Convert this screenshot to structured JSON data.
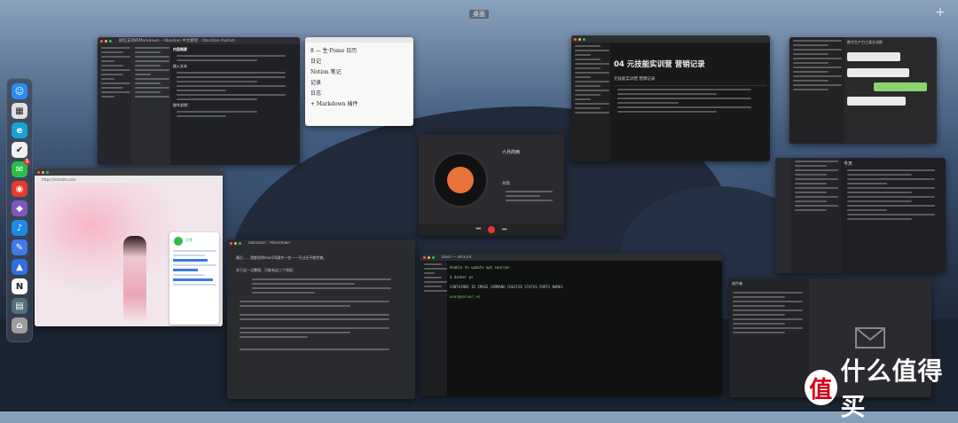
{
  "desktop": {
    "space_label": "桌面",
    "add_space": "+"
  },
  "windows": {
    "joplin": {
      "title": "微信支持的Markdown - Obsidian 中文教程 - Obsidian Publish",
      "heading": "内容概要",
      "section": "插入文本",
      "sub": "指令说明："
    },
    "notes": {
      "lines": [
        "8 — 生·Pomo 日历",
        "日记",
        "Notion 笔记",
        "记录",
        "日志",
        "+ Markdown 插件"
      ]
    },
    "notion": {
      "title": "04 元技能实训营 营销记录",
      "table_title": "元技能实训营 营销记录"
    },
    "music": {
      "song": "六月的雨",
      "artist": "胡歌"
    },
    "browser": {
      "url": "https://smzdm.com",
      "status": "正常"
    },
    "article": {
      "title": "Obsidian · Markdown",
      "p1": "最后……我都觉得macOS操作一些——不过还不够完善。",
      "p2": "关于这一点整理，可能有这三个原因："
    },
    "terminal": {
      "title": "bash — 80×24",
      "lines": [
        "Unable to update apt sources",
        "$ docker ps",
        "CONTAINER ID   IMAGE   COMMAND   CREATED   STATUS   PORTS   NAMES",
        "user@server:~$"
      ]
    },
    "wechat_group": {
      "title": "数字生产力工具交流群"
    },
    "task_app": {
      "title": "今天"
    },
    "mail": {
      "title": "收件箱"
    }
  },
  "dock": {
    "items": [
      {
        "name": "finder-icon",
        "color": "#2a8cf0",
        "glyph": "☺"
      },
      {
        "name": "launchpad-icon",
        "color": "#e0e0e0",
        "glyph": "▦"
      },
      {
        "name": "edge-icon",
        "color": "#1aa0d8",
        "glyph": "e"
      },
      {
        "name": "todo-icon",
        "color": "#f0f0f0",
        "glyph": "✔"
      },
      {
        "name": "wechat-icon",
        "color": "#2bbd4a",
        "glyph": "✉",
        "badge": "1"
      },
      {
        "name": "weibo-icon",
        "color": "#e63b2e",
        "glyph": "◉"
      },
      {
        "name": "obsidian-icon",
        "color": "#7e57c2",
        "glyph": "◆"
      },
      {
        "name": "tiktok-icon",
        "color": "#1e88e5",
        "glyph": "♪"
      },
      {
        "name": "pen-icon",
        "color": "#3f7be8",
        "glyph": "✎"
      },
      {
        "name": "paper-plane-icon",
        "color": "#2f6fe0",
        "glyph": "▲"
      },
      {
        "name": "notion-icon",
        "color": "#ffffff",
        "glyph": "N"
      },
      {
        "name": "finder-window-icon",
        "color": "#546e7a",
        "glyph": "▤"
      },
      {
        "name": "trash-icon",
        "color": "#9e9e9e",
        "glyph": "⌂"
      }
    ]
  },
  "watermark": {
    "mark": "值",
    "text": "什么值得买"
  },
  "colors": {
    "accent_red": "#d0021b"
  }
}
